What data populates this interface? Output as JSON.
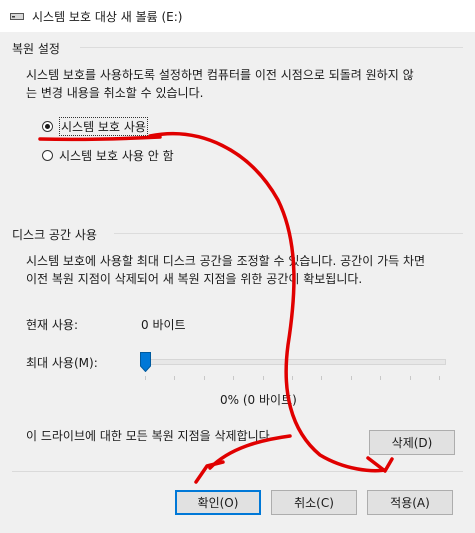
{
  "window": {
    "title": "시스템 보호 대상 새 볼륨 (E:)",
    "icon": "drive-icon"
  },
  "restore_settings": {
    "section_label": "복원 설정",
    "description": "시스템 보호를 사용하도록 설정하면 컴퓨터를 이전 시점으로 되돌려 원하지 않\n는 변경 내용을 취소할 수 있습니다.",
    "options": [
      {
        "label": "시스템 보호 사용",
        "selected": true
      },
      {
        "label": "시스템 보호 사용 안 함",
        "selected": false
      }
    ]
  },
  "disk_usage": {
    "section_label": "디스크 공간 사용",
    "description": "시스템 보호에 사용할 최대 디스크 공간을 조정할 수 있습니다. 공간이 가득 차면\n이전 복원 지점이 삭제되어 새 복원 지점을 위한 공간이 확보됩니다.",
    "current_label": "현재 사용:",
    "current_value": "0 바이트",
    "max_label": "최대 사용(M):",
    "slider_value_fraction": 0,
    "slider_readout": "0% (0 바이트)",
    "delete_text": "이 드라이브에 대한 모든 복원 지점을 삭제합니다.",
    "delete_button": "삭제(D)"
  },
  "footer": {
    "ok": "확인(O)",
    "cancel": "취소(C)",
    "apply": "적용(A)"
  },
  "annotation_color": "#e00000"
}
